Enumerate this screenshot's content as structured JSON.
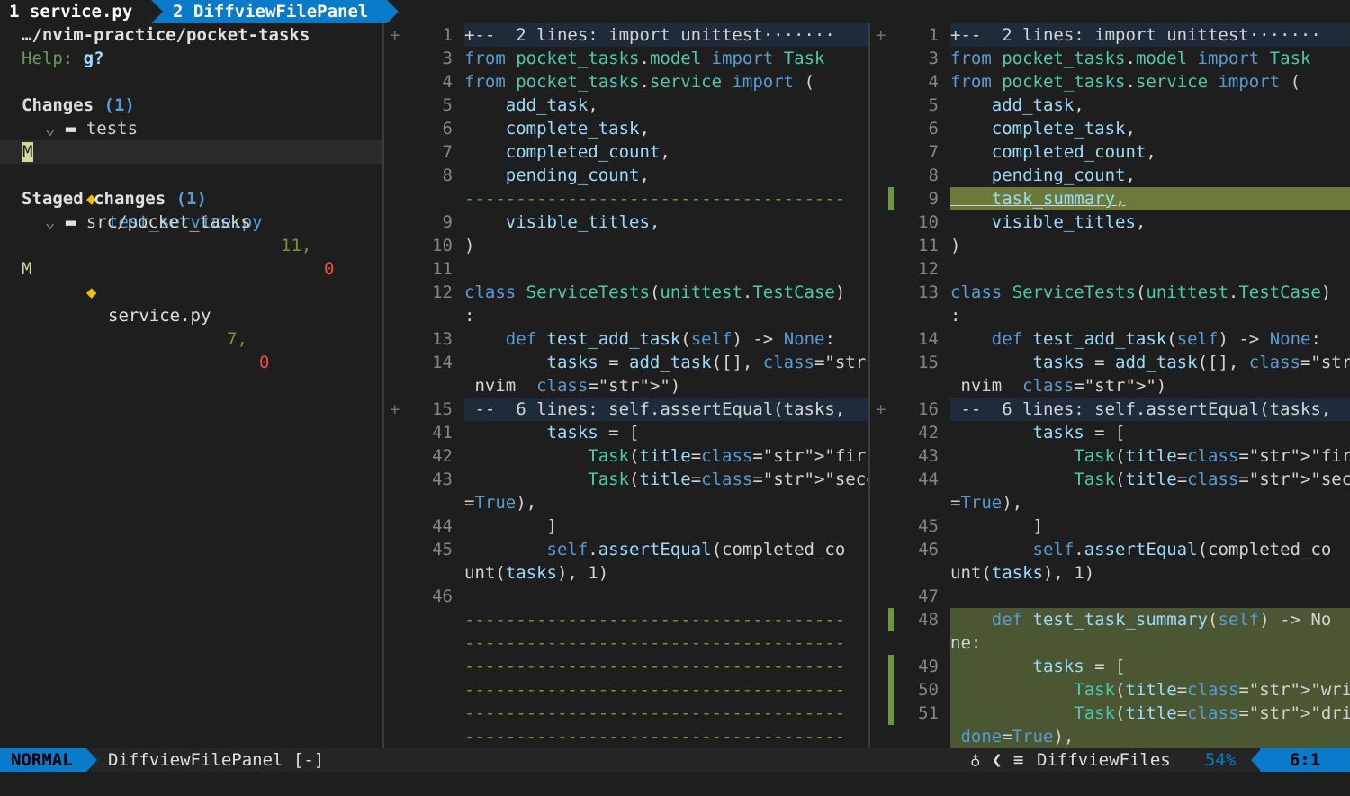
{
  "tabs": [
    {
      "label": "1 service.py"
    },
    {
      "label": "2 DiffviewFilePanel"
    }
  ],
  "panel": {
    "path": "…/nvim-practice/pocket-tasks",
    "help_label": "Help:",
    "help_key": "g?",
    "changes_header": "Changes",
    "changes_count": "(1)",
    "changes_folder": "tests",
    "changes_file": {
      "status": "M",
      "name": "test_service.py",
      "added": "11,",
      "removed": "0"
    },
    "staged_header": "Staged changes",
    "staged_count": "(1)",
    "staged_folder": "src/pocket_tasks",
    "staged_file": {
      "status": "M",
      "name": "service.py",
      "added": "7,",
      "removed": "0"
    }
  },
  "left": {
    "lines": [
      {
        "n": "1",
        "t": "+--  2 lines: import unittest·······"
      },
      {
        "n": "3",
        "t": "from pocket_tasks.model import Task"
      },
      {
        "n": "4",
        "t": "from pocket_tasks.service import ("
      },
      {
        "n": "5",
        "t": "    add_task,"
      },
      {
        "n": "6",
        "t": "    complete_task,"
      },
      {
        "n": "7",
        "t": "    completed_count,"
      },
      {
        "n": "8",
        "t": "    pending_count,"
      },
      {
        "n": "",
        "t": "-------------------------------------"
      },
      {
        "n": "9",
        "t": "    visible_titles,"
      },
      {
        "n": "10",
        "t": ")"
      },
      {
        "n": "11",
        "t": ""
      },
      {
        "n": "12",
        "t": "class ServiceTests(unittest.TestCase)"
      },
      {
        "n": "",
        "t": ":"
      },
      {
        "n": "13",
        "t": "    def test_add_task(self) -> None:"
      },
      {
        "n": "14",
        "t": "        tasks = add_task([], \"  learn"
      },
      {
        "n": "",
        "t": " nvim  \")"
      },
      {
        "n": "15",
        "t": " --  6 lines: self.assertEqual(tasks,"
      },
      {
        "n": "41",
        "t": "        tasks = ["
      },
      {
        "n": "42",
        "t": "            Task(title=\"first\"),"
      },
      {
        "n": "43",
        "t": "            Task(title=\"second\", done"
      },
      {
        "n": "",
        "t": "=True),"
      },
      {
        "n": "44",
        "t": "        ]"
      },
      {
        "n": "45",
        "t": "        self.assertEqual(completed_co"
      },
      {
        "n": "",
        "t": "unt(tasks), 1)"
      },
      {
        "n": "46",
        "t": ""
      },
      {
        "n": "",
        "t": "-------------------------------------"
      },
      {
        "n": "",
        "t": "-------------------------------------"
      },
      {
        "n": "",
        "t": "-------------------------------------"
      },
      {
        "n": "",
        "t": "-------------------------------------"
      },
      {
        "n": "",
        "t": "-------------------------------------"
      },
      {
        "n": "",
        "t": "-------------------------------------"
      }
    ]
  },
  "right": {
    "lines": [
      {
        "n": "1",
        "t": "+--  2 lines: import unittest·······"
      },
      {
        "n": "3",
        "t": "from pocket_tasks.model import Task"
      },
      {
        "n": "4",
        "t": "from pocket_tasks.service import ("
      },
      {
        "n": "5",
        "t": "    add_task,"
      },
      {
        "n": "6",
        "t": "    complete_task,"
      },
      {
        "n": "7",
        "t": "    completed_count,"
      },
      {
        "n": "8",
        "t": "    pending_count,"
      },
      {
        "n": "9",
        "t": "    task_summary,"
      },
      {
        "n": "10",
        "t": "    visible_titles,"
      },
      {
        "n": "11",
        "t": ")"
      },
      {
        "n": "12",
        "t": ""
      },
      {
        "n": "13",
        "t": "class ServiceTests(unittest.TestCase)"
      },
      {
        "n": "",
        "t": ":"
      },
      {
        "n": "14",
        "t": "    def test_add_task(self) -> None:"
      },
      {
        "n": "15",
        "t": "        tasks = add_task([], \"  learn"
      },
      {
        "n": "",
        "t": " nvim  \")"
      },
      {
        "n": "16",
        "t": " --  6 lines: self.assertEqual(tasks,"
      },
      {
        "n": "42",
        "t": "        tasks = ["
      },
      {
        "n": "43",
        "t": "            Task(title=\"first\"),"
      },
      {
        "n": "44",
        "t": "            Task(title=\"second\", done"
      },
      {
        "n": "",
        "t": "=True),"
      },
      {
        "n": "45",
        "t": "        ]"
      },
      {
        "n": "46",
        "t": "        self.assertEqual(completed_co"
      },
      {
        "n": "",
        "t": "unt(tasks), 1)"
      },
      {
        "n": "47",
        "t": ""
      },
      {
        "n": "48",
        "t": "    def test_task_summary(self) -> No"
      },
      {
        "n": "",
        "t": "ne:"
      },
      {
        "n": "49",
        "t": "        tasks = ["
      },
      {
        "n": "50",
        "t": "            Task(title=\"write docs\"),"
      },
      {
        "n": "51",
        "t": "            Task(title=\"drink water\","
      },
      {
        "n": "",
        "t": " done=True),"
      }
    ]
  },
  "status": {
    "mode": "NORMAL",
    "buffer": "DiffviewFilePanel [-]",
    "filetype_icon": "linux-icon",
    "filetype": "DiffviewFiles",
    "percent": "54%",
    "position": "6:1"
  },
  "colors": {
    "accent": "#0a7aca",
    "added_bg": "#4b5632",
    "fold_bg": "#1f2b3a",
    "git_added": "#6a9a38",
    "git_removed": "#f14c4c"
  }
}
